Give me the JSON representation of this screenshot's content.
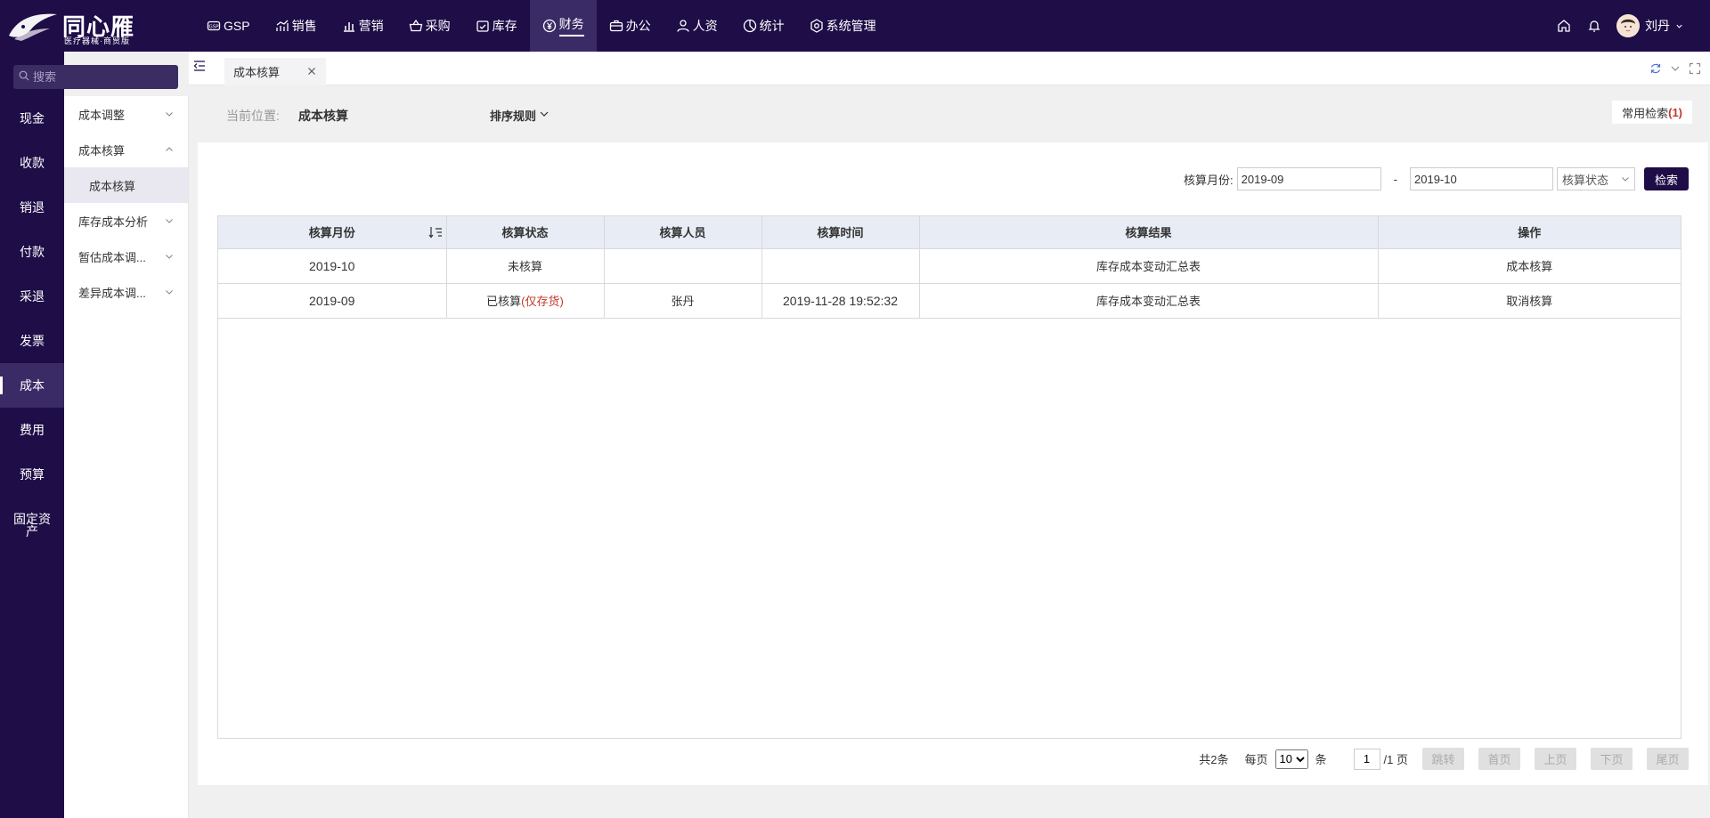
{
  "brand": {
    "name": "同心雁",
    "subtitle": "医疗器械·商贸版"
  },
  "topnav": [
    {
      "label": "GSP",
      "icon": "gsp-icon",
      "active": false
    },
    {
      "label": "销售",
      "icon": "chart-line-icon",
      "active": false
    },
    {
      "label": "营销",
      "icon": "bar-chart-icon",
      "active": false
    },
    {
      "label": "采购",
      "icon": "basket-icon",
      "active": false
    },
    {
      "label": "库存",
      "icon": "calendar-check-icon",
      "active": false
    },
    {
      "label": "财务",
      "icon": "yen-circle-icon",
      "active": true
    },
    {
      "label": "办公",
      "icon": "briefcase-icon",
      "active": false
    },
    {
      "label": "人资",
      "icon": "user-icon",
      "active": false
    },
    {
      "label": "统计",
      "icon": "pie-chart-icon",
      "active": false
    },
    {
      "label": "系统管理",
      "icon": "settings-icon",
      "active": false
    }
  ],
  "user": {
    "name": "刘丹"
  },
  "search": {
    "placeholder": "搜索"
  },
  "sidebar": {
    "items": [
      {
        "label": "现金"
      },
      {
        "label": "收款"
      },
      {
        "label": "销退"
      },
      {
        "label": "付款"
      },
      {
        "label": "采退"
      },
      {
        "label": "发票"
      },
      {
        "label": "成本"
      },
      {
        "label": "费用"
      },
      {
        "label": "预算"
      },
      {
        "label": "固定资产"
      }
    ],
    "active_index": 6
  },
  "submenu": {
    "items": [
      {
        "label": "成本调整",
        "expanded": false
      },
      {
        "label": "成本核算",
        "expanded": true
      },
      {
        "label": "库存成本分析",
        "expanded": false
      },
      {
        "label": "暂估成本调...",
        "expanded": false
      },
      {
        "label": "差异成本调...",
        "expanded": false
      }
    ],
    "child": {
      "label": "成本核算"
    }
  },
  "tabs": [
    {
      "label": "成本核算"
    }
  ],
  "location": {
    "label": "当前位置:",
    "value": "成本核算",
    "sort_rule": "排序规则",
    "common_search": "常用检索",
    "common_search_count": "(1)"
  },
  "filter": {
    "label": "核算月份:",
    "from": "2019-09",
    "dash": "-",
    "to": "2019-10",
    "status_placeholder": "核算状态",
    "search_button": "检索"
  },
  "table": {
    "columns": [
      "核算月份",
      "核算状态",
      "核算人员",
      "核算时间",
      "核算结果",
      "操作"
    ],
    "rows": [
      {
        "month": "2019-10",
        "status": "未核算",
        "status_note": "",
        "person": "",
        "time": "",
        "result": "库存成本变动汇总表",
        "action": "成本核算"
      },
      {
        "month": "2019-09",
        "status": "已核算",
        "status_note": "(仅存货)",
        "person": "张丹",
        "time": "2019-11-28 19:52:32",
        "result": "库存成本变动汇总表",
        "action": "取消核算"
      }
    ]
  },
  "pager": {
    "total": "共2条",
    "per_page_label": "每页",
    "per_page_value": "10",
    "per_page_unit": "条",
    "page_value": "1",
    "page_total": "/1 页",
    "jump": "跳转",
    "first": "首页",
    "prev": "上页",
    "next": "下页",
    "last": "尾页"
  },
  "colors": {
    "brand_dark": "#1e0d47",
    "active_nav": "#3a2a66",
    "header_row": "#e8ecf5",
    "note_red": "#c0392b"
  }
}
